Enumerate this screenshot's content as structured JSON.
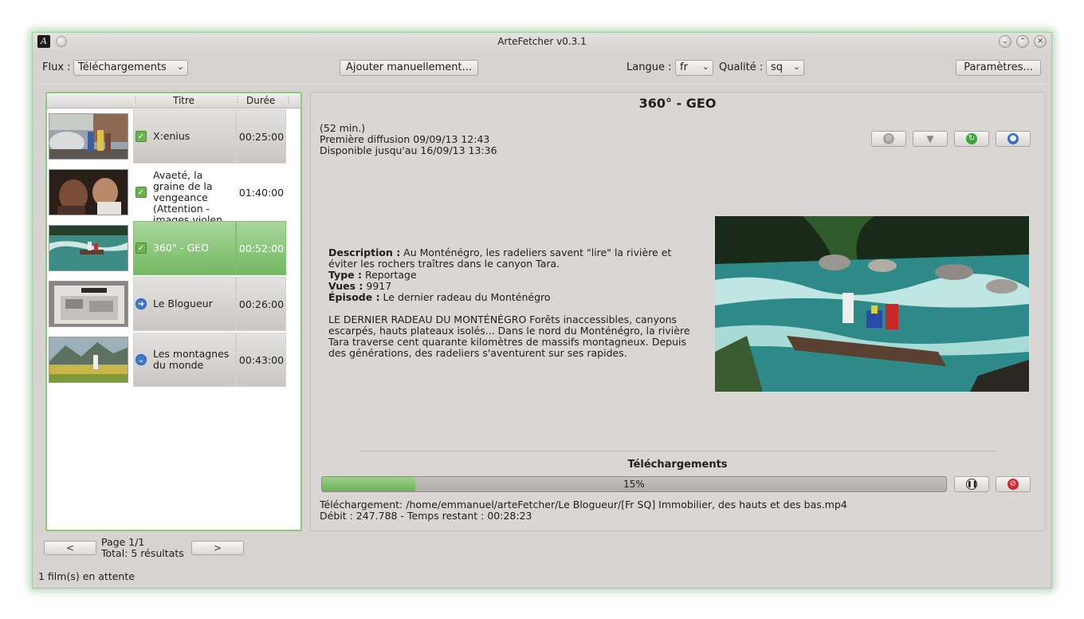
{
  "window": {
    "title": "ArteFetcher v0.3.1",
    "icon_text": "A"
  },
  "toolbar": {
    "flux_label": "Flux :",
    "flux_value": "Téléchargements",
    "add_manual_label": "Ajouter manuellement...",
    "langue_label": "Langue :",
    "langue_value": "fr",
    "qualite_label": "Qualité :",
    "qualite_value": "sq",
    "settings_label": "Paramètres..."
  },
  "list": {
    "columns": {
      "title": "Titre",
      "duration": "Durée"
    },
    "rows": [
      {
        "title": "X:enius",
        "duration": "00:25:00",
        "status": "checked"
      },
      {
        "title": "Avaeté, la graine de la vengeance (Attention - images violen...",
        "duration": "01:40:00",
        "status": "checked"
      },
      {
        "title": "360° - GEO",
        "duration": "00:52:00",
        "status": "checked"
      },
      {
        "title": "Le Blogueur",
        "duration": "00:26:00",
        "status": "downloading"
      },
      {
        "title": "Les montagnes du monde",
        "duration": "00:43:00",
        "status": "queued"
      }
    ]
  },
  "pagination": {
    "prev_label": "<",
    "next_label": ">",
    "page": "Page 1/1",
    "total": "Total: 5 résultats"
  },
  "status_bar": "1 film(s) en attente",
  "detail": {
    "title": "360° - GEO",
    "length": "(52 min.)",
    "first_broadcast": "Première diffusion 09/09/13 12:43",
    "available_until": "Disponible jusqu'au 16/09/13 13:36",
    "description_label": "Description :",
    "description": " Au Monténégro, les radeliers savent \"lire\" la rivière et éviter les rochers traîtres dans le canyon Tara.",
    "type_label": "Type :",
    "type": " Reportage",
    "views_label": "Vues :",
    "views": " 9917",
    "episode_label": "Épisode :",
    "episode": " Le dernier radeau du Monténégro",
    "long_text": "LE DERNIER RADEAU DU MONTÉNÉGRO Forêts inaccessibles, canyons escarpés, hauts plateaux isolés... Dans le nord du Monténégro, la rivière Tara traverse cent quarante kilomètres de massifs montagneux. Depuis des générations, des radeliers s'aventurent sur ses rapides."
  },
  "downloads": {
    "title": "Téléchargements",
    "progress": 0.15,
    "progress_label": "15%",
    "file_line": "Téléchargement: /home/emmanuel/arteFetcher/Le Blogueur/[Fr SQ] Immobilier, des hauts et des bas.mp4",
    "speed_line": "Débit : 247.788  -  Temps restant : 00:28:23"
  },
  "colors": {
    "accent_green": "#73b862",
    "panel_border": "#8ccb7c",
    "cancel_red": "#d8262a"
  }
}
